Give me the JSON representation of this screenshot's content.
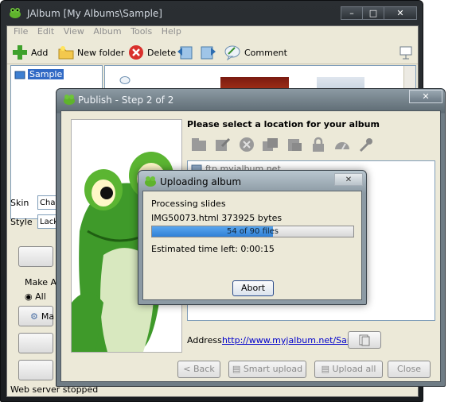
{
  "main_window": {
    "title": "JAlbum [My Albums\\Sample]",
    "menu": [
      "File",
      "Edit",
      "View",
      "Album",
      "Tools",
      "Help"
    ],
    "toolbar": {
      "add": "Add",
      "new_folder": "New folder",
      "delete": "Delete",
      "comment": "Comment"
    },
    "tree": {
      "selected": "Sample"
    },
    "skin": {
      "label": "Skin",
      "value": "Chan"
    },
    "style": {
      "label": "Style",
      "value": "Lack"
    },
    "make_album_label": "Make Alb",
    "all_label": "All",
    "make_button_label": "Ma",
    "status": "Web server stopped"
  },
  "publish_window": {
    "title": "Publish - Step 2 of 2",
    "heading": "Please select a location for your album",
    "list_items": [
      "ftp.myjalbum.net"
    ],
    "address_label": "Address",
    "address_url": "http://www.myjalbum.net/Sample",
    "buttons": {
      "back": "< Back",
      "smart_upload": "Smart upload",
      "upload_all": "Upload all",
      "close": "Close"
    }
  },
  "upload_dialog": {
    "title": "Uploading album",
    "status": "Processing slides",
    "file": "IMG50073.html 373925 bytes",
    "progress_text": "54 of 90 files",
    "progress_fraction": 0.6,
    "eta": "Estimated time left: 0:00:15",
    "abort": "Abort"
  },
  "colors": {
    "progress_fill": "#2f7fd6",
    "link": "#0000cc",
    "selection": "#316ac5"
  }
}
